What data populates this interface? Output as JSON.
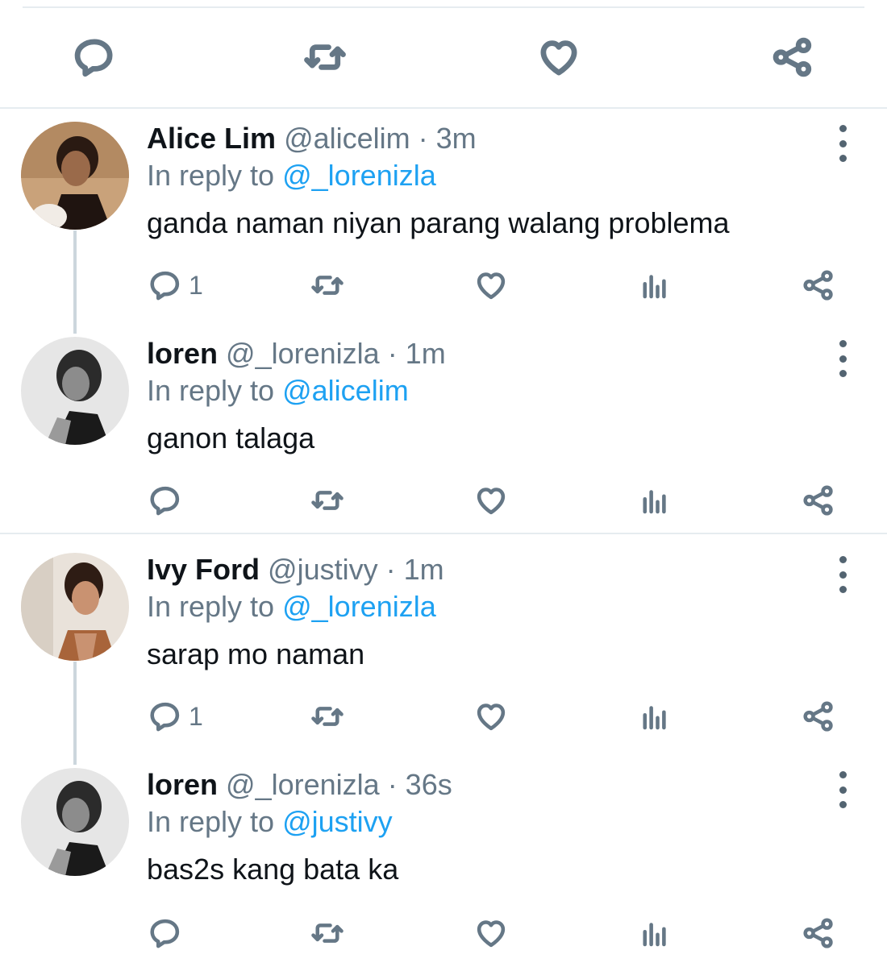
{
  "tweets": [
    {
      "name": "Alice Lim",
      "handle": "@alicelim",
      "time": "· 3m",
      "reply_prefix": "In reply to",
      "reply_to": "@_lorenizla",
      "text": "ganda naman niyan parang walang problema",
      "reply_count": "1",
      "avatar": "color-portrait-woman"
    },
    {
      "name": "loren",
      "handle": "@_lorenizla",
      "time": "· 1m",
      "reply_prefix": "In reply to",
      "reply_to": "@alicelim",
      "text": "ganon talaga",
      "reply_count": "",
      "avatar": "bw-portrait-woman"
    },
    {
      "name": "Ivy Ford",
      "handle": "@justivy",
      "time": "· 1m",
      "reply_prefix": "In reply to",
      "reply_to": "@_lorenizla",
      "text": "sarap mo naman",
      "reply_count": "1",
      "avatar": "color-portrait-woman"
    },
    {
      "name": "loren",
      "handle": "@_lorenizla",
      "time": "· 36s",
      "reply_prefix": "In reply to",
      "reply_to": "@justivy",
      "text": "bas2s kang bata ka",
      "reply_count": "",
      "avatar": "bw-portrait-woman"
    }
  ],
  "icons": {
    "reply": "reply-icon",
    "retweet": "retweet-icon",
    "like": "heart-icon",
    "analytics": "analytics-icon",
    "share": "share-icon",
    "more": "more-vertical-icon"
  },
  "colors": {
    "name": "#0f1419",
    "meta": "#657786",
    "mention": "#1da1f2",
    "divider": "#e6ecf0"
  }
}
